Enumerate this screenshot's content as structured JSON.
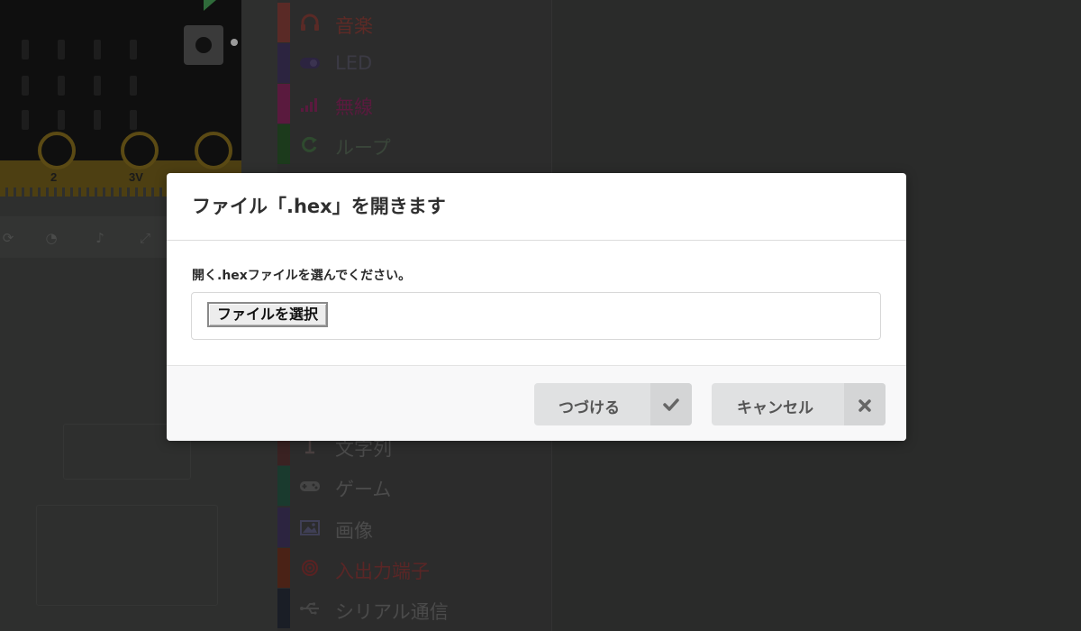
{
  "board": {
    "pin_labels": [
      "2",
      "3V"
    ]
  },
  "toolbox": {
    "categories_top": [
      {
        "label": "音楽",
        "icon": "headphones-icon",
        "color": "#e63022"
      },
      {
        "label": "LED",
        "icon": "toggle-icon",
        "color": "#5c2d91"
      },
      {
        "label": "無線",
        "icon": "signal-bars-icon",
        "color": "#e3008c"
      },
      {
        "label": "ループ",
        "icon": "refresh-icon",
        "color": "#00aa00"
      }
    ],
    "categories_bottom": [
      {
        "label": "文字列",
        "icon": "text-cursor-icon",
        "color": "#a80000"
      },
      {
        "label": "ゲーム",
        "icon": "gamepad-icon",
        "color": "#007a4b"
      },
      {
        "label": "画像",
        "icon": "image-icon",
        "color": "#5c2d91"
      },
      {
        "label": "入出力端子",
        "icon": "target-icon",
        "color": "#b4009e"
      },
      {
        "label": "シリアル通信",
        "icon": "usb-icon",
        "color": "#002050"
      }
    ]
  },
  "dialog": {
    "title": "ファイル「.hex」を開きます",
    "prompt": "開く.hexファイルを選んでください。",
    "file_button_label": "ファイルを選択",
    "continue_label": "つづける",
    "cancel_label": "キャンセル"
  },
  "colors": {
    "overlay_bg": "#2a2b2a",
    "dialog_bg": "#ffffff",
    "button_bg": "#e0e1e2"
  }
}
